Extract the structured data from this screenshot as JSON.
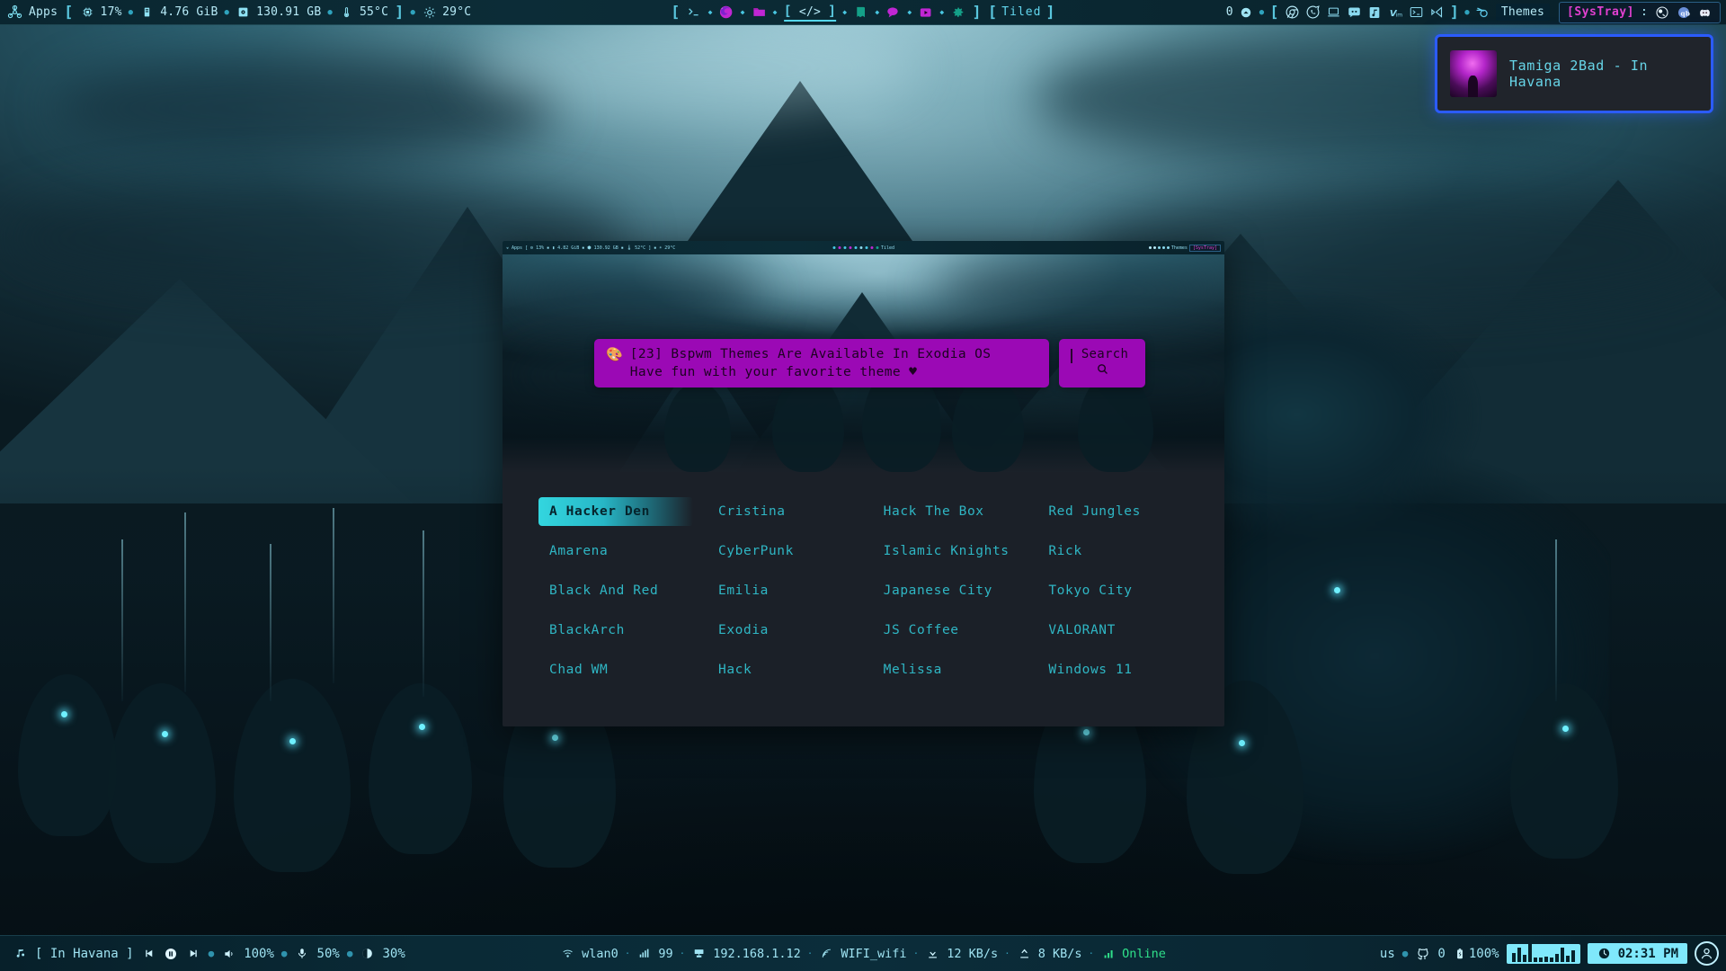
{
  "topbar": {
    "apps_label": "Apps",
    "system_stats": [
      {
        "icon": "cpu-icon",
        "value": "17%"
      },
      {
        "icon": "ram-icon",
        "value": "4.76 GiB"
      },
      {
        "icon": "disk-icon",
        "value": "130.91 GB"
      },
      {
        "icon": "temperature-icon",
        "value": "55°C"
      }
    ],
    "weather": {
      "icon": "weather-sun-icon",
      "value": "29°C"
    },
    "launchers": [
      {
        "name": "terminal-icon",
        "glyph": ">_",
        "active": false
      },
      {
        "name": "firefox-icon",
        "glyph": "",
        "active": false
      },
      {
        "name": "files-icon",
        "glyph": "",
        "active": false
      },
      {
        "name": "code-icon",
        "glyph": "</>",
        "active": true
      },
      {
        "name": "book-icon",
        "glyph": "",
        "active": false
      },
      {
        "name": "chat-icon",
        "glyph": "",
        "active": false
      },
      {
        "name": "video-icon",
        "glyph": "",
        "active": false
      },
      {
        "name": "settings-gear-icon",
        "glyph": "",
        "active": false
      }
    ],
    "layout_label": "Tiled",
    "window_count": "0",
    "tray_apps": [
      "chrome-icon",
      "whatsapp-icon",
      "laptop-icon",
      "discord-icon",
      "music-icon",
      "vim-icon",
      "terminal-icon",
      "vscode-icon"
    ],
    "themes_label": "Themes",
    "themes_icon": "blender-icon",
    "systray_label": "[SysTray]",
    "systray_colon": ":",
    "systray_icons": [
      "obs-icon",
      "qbittorrent-icon",
      "discord-icon"
    ]
  },
  "notification": {
    "title": "Tamiga 2Bad - In Havana",
    "art_name": "album-art",
    "border_color": "#2b5bff"
  },
  "dialog": {
    "prompt_icon": "palette-icon",
    "prompt_line1": "[23] Bspwm Themes Are Available In Exodia OS",
    "prompt_line2": "Have fun with your favorite theme ♥",
    "search_label": "Search",
    "search_icon": "magnifier-icon",
    "search_value": "",
    "accent_color": "#9b09b5",
    "selected_theme": "A Hacker Den",
    "themes": [
      "A Hacker Den",
      "Cristina",
      "Hack The Box",
      "Red Jungles",
      "Amarena",
      "CyberPunk",
      "Islamic Knights",
      "Rick",
      "Black And Red",
      "Emilia",
      "Japanese City",
      "Tokyo City",
      "BlackArch",
      "Exodia",
      "JS Coffee",
      "VALORANT",
      "Chad WM",
      "Hack",
      "Melissa",
      "Windows 11"
    ]
  },
  "bottombar": {
    "music_icon": "music-note-icon",
    "now_playing": "[ In Havana ]",
    "prev_icon": "previous-track-icon",
    "play_pause_icon": "pause-icon",
    "next_icon": "next-track-icon",
    "volume_icon": "volume-icon",
    "volume": "100%",
    "mic_icon": "microphone-icon",
    "mic": "50%",
    "brightness_icon": "brightness-icon",
    "brightness": "30%",
    "network": {
      "wifi_icon": "wifi-icon",
      "interface": "wlan0",
      "signal_icon": "signal-strength-icon",
      "signal": "99",
      "ip_icon": "ethernet-icon",
      "ip": "192.168.1.12",
      "ssid_icon": "broadcast-icon",
      "ssid": "WIFI_wifi",
      "download_icon": "download-icon",
      "download": "12 KB/s",
      "upload_icon": "upload-icon",
      "upload": "8 KB/s",
      "status_icon": "bars-icon",
      "status": "Online",
      "status_color": "#2fe08a"
    },
    "keyboard_layout": "us",
    "github_icon": "github-icon",
    "github_count": "0",
    "battery_icon": "battery-charging-icon",
    "battery": "100%",
    "visualizer_icon": "audio-visualizer",
    "visualizer_bars": [
      10,
      16,
      8,
      20,
      5,
      5,
      6,
      5,
      9,
      16,
      7,
      13
    ],
    "clock_icon": "clock-icon",
    "time": "02:31 PM",
    "avatar_icon": "user-avatar-icon"
  }
}
